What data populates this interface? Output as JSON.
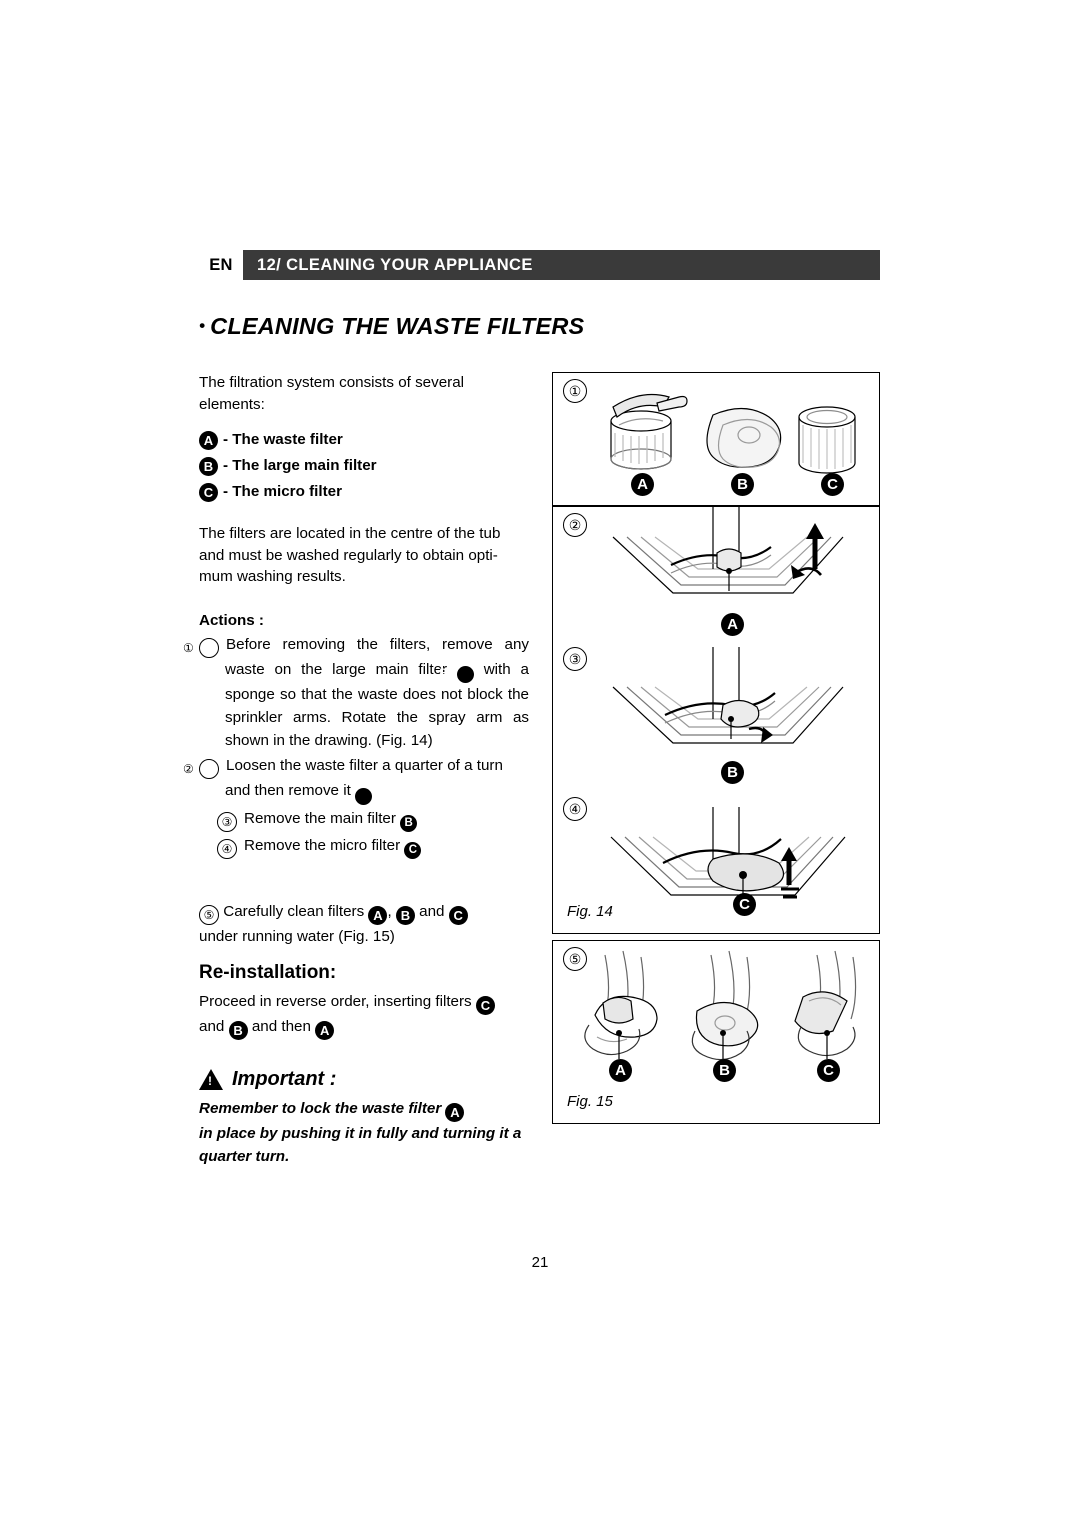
{
  "header": {
    "lang": "EN",
    "title": "12/ CLEANING YOUR APPLIANCE"
  },
  "section": {
    "bullet": "•",
    "title": "CLEANING THE WASTE FILTERS"
  },
  "left": {
    "intro": "The filtration system consists of several elements:",
    "legend": [
      {
        "badge": "A",
        "text": "- The waste filter"
      },
      {
        "badge": "B",
        "text": "- The large main filter"
      },
      {
        "badge": "C",
        "text": "- The micro filter"
      }
    ],
    "paragraph2": "The filters are located in the centre of the tub and must be washed regularly to obtain opti-mum washing results.",
    "actions_label": "Actions :",
    "step1_a": "Before removing the filters, remove any waste on the large main filter",
    "step1_badge": "B",
    "step1_b": "with a sponge so that the waste does not block the sprinkler arms. Rotate the spray arm as shown in the drawing. (Fig. 14)",
    "step2_a": "Loosen the waste filter a quarter of a turn and then remove it",
    "step2_badge": "A",
    "step3_a": "Remove the main filter",
    "step3_badge": "B",
    "step4_a": "Remove the micro filter",
    "step4_badge": "C",
    "step5_a": "Carefully clean filters",
    "step5_badge_a": "A",
    "step5_sep": ",",
    "step5_badge_b": "B",
    "step5_and": "and",
    "step5_badge_c": "C",
    "step5_b": "under running water (Fig. 15)",
    "reinstall_title": "Re-installation:",
    "reinstall_a": "Proceed in reverse order, inserting filters",
    "reinstall_badge_c": "C",
    "reinstall_b": "and",
    "reinstall_badge_b": "B",
    "reinstall_c": "and then",
    "reinstall_badge_a": "A",
    "important_label": "Important :",
    "important_line1": "Remember to lock the waste filter",
    "important_badge": "A",
    "important_line2": "in place by pushing it in fully and turning it a quarter turn.",
    "numbers": {
      "n1": "①",
      "n2": "②",
      "n3": "③",
      "n4": "④",
      "n5": "⑤"
    }
  },
  "figures": {
    "fig1": {
      "marker": "1",
      "labels": [
        "A",
        "B",
        "C"
      ]
    },
    "fig14": {
      "markers": [
        "2",
        "3",
        "4"
      ],
      "labels": [
        "A",
        "B",
        "C"
      ],
      "caption": "Fig. 14"
    },
    "fig15": {
      "marker": "5",
      "labels": [
        "A",
        "B",
        "C"
      ],
      "caption": "Fig. 15"
    }
  },
  "footer": {
    "page_number": "21"
  },
  "colors": {
    "header_bg": "#3a3a3a",
    "text": "#000000",
    "page_bg": "#ffffff",
    "line_gray": "#8c8c8c"
  }
}
